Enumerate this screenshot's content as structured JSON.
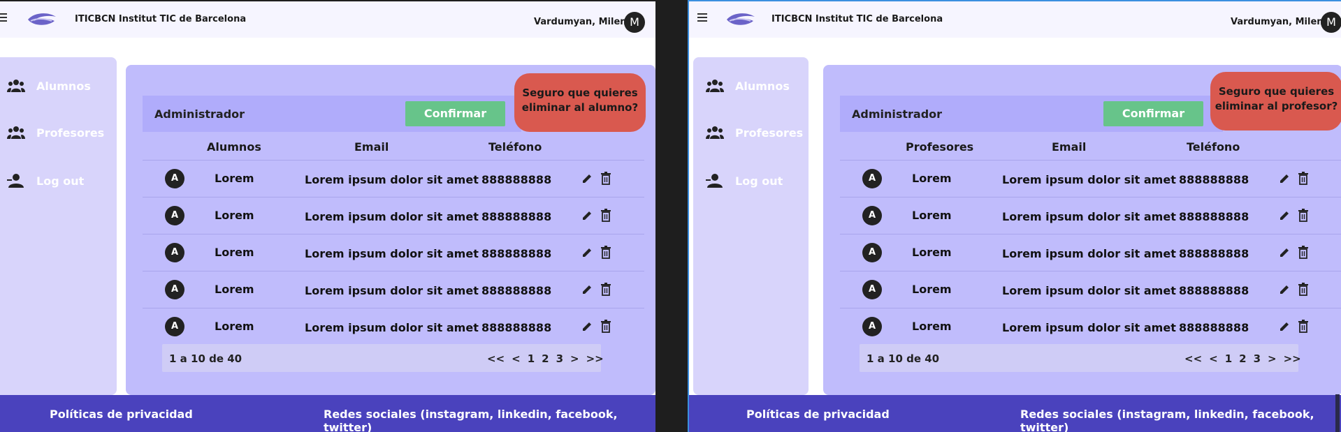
{
  "colors": {
    "accent": "#4a42bd",
    "confirm": "#67c48a",
    "alert": "#d9594f",
    "sidebar": "#d8d4fb",
    "main": "#c0bcfc"
  },
  "left": {
    "header": {
      "org": "ITICBCN Institut TIC de Barcelona",
      "user": "Vardumyan, Milena",
      "avatar": "M"
    },
    "sidebar": {
      "items": [
        {
          "label": "Alumnos",
          "icon": "group-icon"
        },
        {
          "label": "Profesores",
          "icon": "group-icon"
        },
        {
          "label": "Log out",
          "icon": "person-icon"
        }
      ]
    },
    "admin": {
      "label": "Administrador",
      "confirm": "Confirmar",
      "alert": "Seguro que quieres eliminar al alumno?"
    },
    "table": {
      "headers": [
        "Alumnos",
        "Email",
        "Teléfono"
      ],
      "rows": [
        {
          "avatar": "A",
          "name": "Lorem",
          "email": "Lorem ipsum dolor sit amet",
          "phone": "888888888"
        },
        {
          "avatar": "A",
          "name": "Lorem",
          "email": "Lorem ipsum dolor sit amet",
          "phone": "888888888"
        },
        {
          "avatar": "A",
          "name": "Lorem",
          "email": "Lorem ipsum dolor sit amet",
          "phone": "888888888"
        },
        {
          "avatar": "A",
          "name": "Lorem",
          "email": "Lorem ipsum dolor sit amet",
          "phone": "888888888"
        },
        {
          "avatar": "A",
          "name": "Lorem",
          "email": "Lorem ipsum dolor sit amet",
          "phone": "888888888"
        }
      ]
    },
    "pager": {
      "count": "1 a 10 de 40",
      "first": "<<",
      "prev": "<",
      "p1": "1",
      "p2": "2",
      "p3": "3",
      "next": ">",
      "last": ">>"
    },
    "footer": {
      "privacy": "Políticas de privacidad",
      "social": "Redes sociales (instagram, linkedin, facebook, twitter)"
    }
  },
  "right": {
    "header": {
      "org": "ITICBCN Institut TIC de Barcelona",
      "user": "Vardumyan, Milena",
      "avatar": "M"
    },
    "sidebar": {
      "items": [
        {
          "label": "Alumnos",
          "icon": "group-icon"
        },
        {
          "label": "Profesores",
          "icon": "group-icon"
        },
        {
          "label": "Log out",
          "icon": "person-icon"
        }
      ]
    },
    "admin": {
      "label": "Administrador",
      "confirm": "Confirmar",
      "alert": "Seguro que quieres eliminar al profesor?"
    },
    "table": {
      "headers": [
        "Profesores",
        "Email",
        "Teléfono"
      ],
      "rows": [
        {
          "avatar": "A",
          "name": "Lorem",
          "email": "Lorem ipsum dolor sit amet",
          "phone": "888888888"
        },
        {
          "avatar": "A",
          "name": "Lorem",
          "email": "Lorem ipsum dolor sit amet",
          "phone": "888888888"
        },
        {
          "avatar": "A",
          "name": "Lorem",
          "email": "Lorem ipsum dolor sit amet",
          "phone": "888888888"
        },
        {
          "avatar": "A",
          "name": "Lorem",
          "email": "Lorem ipsum dolor sit amet",
          "phone": "888888888"
        },
        {
          "avatar": "A",
          "name": "Lorem",
          "email": "Lorem ipsum dolor sit amet",
          "phone": "888888888"
        }
      ]
    },
    "pager": {
      "count": "1 a 10 de 40",
      "first": "<<",
      "prev": "<",
      "p1": "1",
      "p2": "2",
      "p3": "3",
      "next": ">",
      "last": ">>"
    },
    "footer": {
      "privacy": "Políticas de privacidad",
      "social": "Redes sociales (instagram, linkedin, facebook, twitter)"
    }
  }
}
